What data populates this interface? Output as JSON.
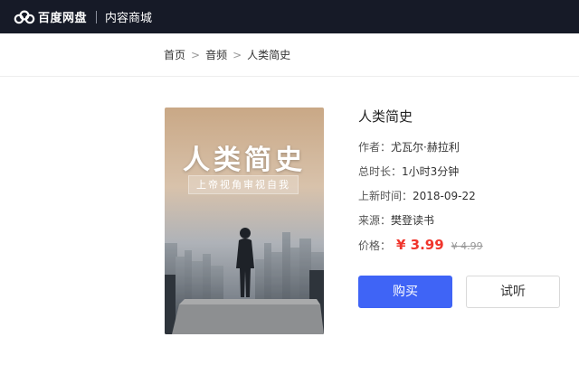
{
  "header": {
    "logo_text": "百度网盘",
    "section_title": "内容商城"
  },
  "breadcrumb": {
    "items": [
      "首页",
      "音频",
      "人类简史"
    ],
    "separator": ">"
  },
  "cover": {
    "title": "人类简史",
    "subtitle": "上帝视角审视自我"
  },
  "product": {
    "title": "人类简史",
    "author_label": "作者：",
    "author": "尤瓦尔·赫拉利",
    "duration_label": "总时长：",
    "duration": "1小时3分钟",
    "release_label": "上新时间：",
    "release_date": "2018-09-22",
    "source_label": "来源：",
    "source": "樊登读书",
    "price_label": "价格：",
    "price": "¥ 3.99",
    "original_price": "¥ 4.99"
  },
  "actions": {
    "buy_label": "购买",
    "trial_label": "试听"
  },
  "colors": {
    "topbar": "#161a27",
    "accent": "#3f64f6",
    "price": "#f0352c"
  }
}
